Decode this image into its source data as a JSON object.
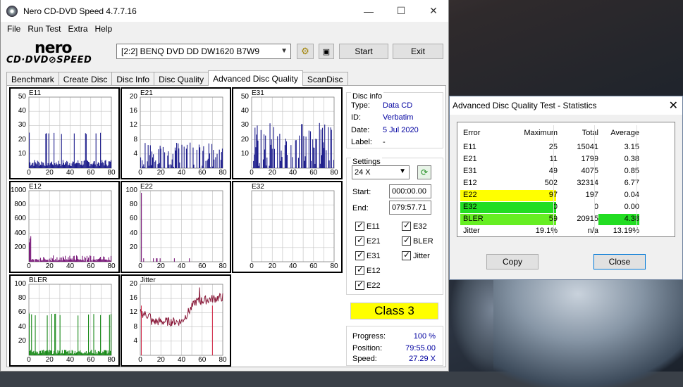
{
  "window": {
    "title": "Nero CD-DVD Speed 4.7.7.16",
    "minimize": "—",
    "maximize": "☐",
    "close": "✕"
  },
  "menu": [
    "File",
    "Run Test",
    "Extra",
    "Help"
  ],
  "logo": {
    "line1": "nero",
    "line2": "CD·DVD⊘SPEED"
  },
  "toolbar": {
    "drive": "[2:2]   BENQ DVD DD DW1620 B7W9",
    "start_label": "Start",
    "exit_label": "Exit"
  },
  "tabs": [
    "Benchmark",
    "Create Disc",
    "Disc Info",
    "Disc Quality",
    "Advanced Disc Quality",
    "ScanDisc"
  ],
  "active_tab": "Advanced Disc Quality",
  "disc_info": {
    "title": "Disc info",
    "type_label": "Type:",
    "type_value": "Data CD",
    "id_label": "ID:",
    "id_value": "Verbatim",
    "date_label": "Date:",
    "date_value": "5 Jul 2020",
    "label_label": "Label:",
    "label_value": "-"
  },
  "settings": {
    "title": "Settings",
    "speed": "24 X",
    "start_label": "Start:",
    "start_value": "000:00.00",
    "end_label": "End:",
    "end_value": "079:57.71",
    "checks": [
      "E11",
      "E32",
      "E21",
      "BLER",
      "E31",
      "Jitter",
      "E12",
      "E22"
    ]
  },
  "class_label": "Class 3",
  "progress": {
    "progress_label": "Progress:",
    "progress_value": "100 %",
    "position_label": "Position:",
    "position_value": "79:55.00",
    "speed_label": "Speed:",
    "speed_value": "27.29 X"
  },
  "stats": {
    "title": "Advanced Disc Quality Test - Statistics",
    "headers": [
      "Error",
      "Maximum",
      "Total",
      "Average"
    ],
    "rows": [
      {
        "error": "E11",
        "max": "25",
        "total": "15041",
        "avg": "3.15"
      },
      {
        "error": "E21",
        "max": "11",
        "total": "1799",
        "avg": "0.38"
      },
      {
        "error": "E31",
        "max": "49",
        "total": "4075",
        "avg": "0.85"
      },
      {
        "error": "E12",
        "max": "502",
        "total": "32314",
        "avg": "6.77"
      },
      {
        "error": "E22",
        "max": "97",
        "total": "197",
        "avg": "0.04"
      },
      {
        "error": "E32",
        "max": "0",
        "total": "0",
        "avg": "0.00"
      },
      {
        "error": "BLER",
        "max": "59",
        "total": "20915",
        "avg": "4.38"
      },
      {
        "error": "Jitter",
        "max": "19.1%",
        "total": "n/a",
        "avg": "13.19%"
      }
    ],
    "copy_label": "Copy",
    "close_label": "Close"
  },
  "colors": {
    "bar": "#1e1e8c",
    "e12": "#7a1a7a",
    "bler": "#1a8a1a",
    "jitter": "#8a1a3a",
    "yellow": "#ffff00",
    "green": "#22dd22",
    "lime": "#66ee22"
  },
  "chart_data": [
    {
      "type": "bar",
      "title": "E11",
      "xlim": [
        0,
        80
      ],
      "ylim": [
        0,
        50
      ],
      "yticks": [
        10,
        20,
        30,
        40,
        50
      ],
      "xticks": [
        0,
        20,
        40,
        60,
        80
      ],
      "max": 25,
      "avg": 3.15
    },
    {
      "type": "bar",
      "title": "E21",
      "xlim": [
        0,
        80
      ],
      "ylim": [
        0,
        20
      ],
      "yticks": [
        4,
        8,
        12,
        16,
        20
      ],
      "xticks": [
        0,
        20,
        40,
        60,
        80
      ],
      "max": 11,
      "avg": 0.38
    },
    {
      "type": "bar",
      "title": "E31",
      "xlim": [
        0,
        80
      ],
      "ylim": [
        0,
        50
      ],
      "yticks": [
        10,
        20,
        30,
        40,
        50
      ],
      "xticks": [
        0,
        20,
        40,
        60,
        80
      ],
      "max": 49,
      "avg": 0.85
    },
    {
      "type": "bar",
      "title": "E12",
      "xlim": [
        0,
        80
      ],
      "ylim": [
        0,
        1000
      ],
      "yticks": [
        200,
        400,
        600,
        800,
        1000
      ],
      "xticks": [
        0,
        20,
        40,
        60,
        80
      ],
      "max": 502,
      "avg": 6.77
    },
    {
      "type": "bar",
      "title": "E22",
      "xlim": [
        0,
        80
      ],
      "ylim": [
        0,
        100
      ],
      "yticks": [
        20,
        40,
        60,
        80,
        100
      ],
      "xticks": [
        0,
        20,
        40,
        60,
        80
      ],
      "max": 97,
      "avg": 0.04
    },
    {
      "type": "bar",
      "title": "E32",
      "xlim": [
        0,
        80
      ],
      "ylim": [
        0,
        5
      ],
      "yticks": [],
      "xticks": [
        0,
        20,
        40,
        60,
        80
      ],
      "max": 0,
      "avg": 0
    },
    {
      "type": "bar",
      "title": "BLER",
      "xlim": [
        0,
        80
      ],
      "ylim": [
        0,
        100
      ],
      "yticks": [
        20,
        40,
        60,
        80,
        100
      ],
      "xticks": [
        0,
        20,
        40,
        60,
        80
      ],
      "max": 59,
      "avg": 4.38
    },
    {
      "type": "line",
      "title": "Jitter",
      "xlim": [
        0,
        80
      ],
      "ylim": [
        0,
        20
      ],
      "yticks": [
        4,
        8,
        12,
        16,
        20
      ],
      "xticks": [
        0,
        20,
        40,
        60,
        80
      ],
      "max": 19.1,
      "avg": 13.19
    }
  ]
}
